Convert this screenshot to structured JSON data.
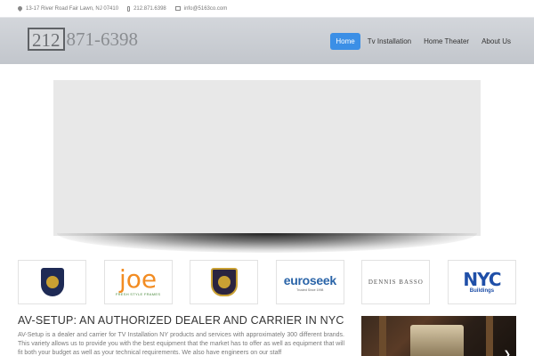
{
  "topbar": {
    "address": "13-17 River Road Fair Lawn, NJ 07410",
    "phone": "212.871.6398",
    "email": "info@5163co.com"
  },
  "header": {
    "logo_area_code": "212",
    "logo_number": "871-6398",
    "nav": [
      {
        "label": "Home",
        "active": true
      },
      {
        "label": "Tv Installation",
        "active": false
      },
      {
        "label": "Home Theater",
        "active": false
      },
      {
        "label": "About Us",
        "active": false
      }
    ]
  },
  "partners": {
    "joe_name": "joe",
    "joe_sub": "FRESH STYLE FRAMES",
    "euroseek_name": "euroseek",
    "euroseek_tag": "Trusted Since 1998",
    "basso_name": "DENNIS BASSO",
    "nyc_name": "NYC",
    "nyc_sub": "Buildings"
  },
  "content": {
    "title": "AV-SETUP: AN AUTHORIZED DEALER AND CARRIER IN NYC",
    "body": "AV-Setup is a dealer and carrier for TV Installation NY products and services with approximately 300 different brands. This variety allows us to provide you with the best equipment that the market has to offer as well as equipment that will fit both your budget as well as your technical requirements. We also have engineers on our staff"
  },
  "colors": {
    "accent": "#3b8fe6",
    "header_bg": "#c9ccd1"
  }
}
